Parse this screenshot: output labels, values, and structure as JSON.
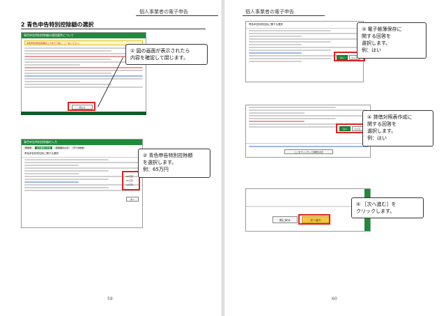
{
  "left_page": {
    "header": "個人事業者の電子申告",
    "section_title": "2 青色申告特別控除額の選択",
    "page_number": "59",
    "modal": {
      "title": "青色申告特別控除額の適用要件について",
      "warning": "青色申告特別控除額の入力を行う前に、ご一読ください。",
      "close_button": "閉じる"
    },
    "input_screen": {
      "title": "青色申告特別控除額の入力",
      "steps": [
        "申告者",
        "決算書類の作成",
        "控除額の入力",
        "データ作成"
      ],
      "heading": "青色申告特別控除に関する選択",
      "options": [
        "65万円",
        "55万円",
        "10万円"
      ],
      "next_button": "次へ"
    },
    "callout1": "① 図の画面が表示されたら\n内容を確認して閉じます。",
    "callout2": "② 青色申告特別控除額\nを選択します。\n例：65万円"
  },
  "right_page": {
    "header": "個人事業者の電子申告",
    "page_number": "60",
    "screen_a_title": "青色申告特別控除に関する選択",
    "answer_yes": "はい",
    "answer_no": "いいえ",
    "screen_b_info_link": "ここをクリックして詳細を表示",
    "back_button": "前に戻る",
    "next_button": "次へ進む",
    "callout3": "③ 電子帳簿保存に\n関する回答を\n選択します。\n例：はい",
    "callout4": "④ 貸借対照表作成に\n関する回答を\n選択します。\n例：はい",
    "callout5": "⑤ ［次へ進む］を\nクリックします。"
  }
}
